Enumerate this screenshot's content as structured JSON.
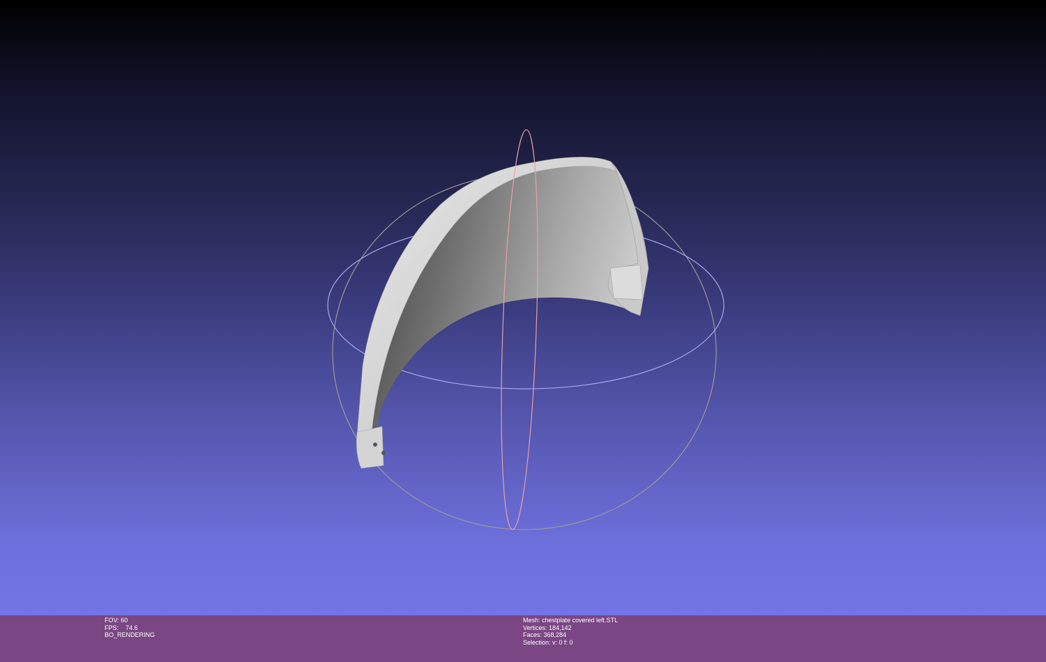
{
  "viewer": {
    "mesh_name": "chestplate covered left.STL"
  },
  "status_left": {
    "fov": "FOV: 60",
    "fps": "FPS:    74.6",
    "render_mode": "BO_RENDERING"
  },
  "status_right": {
    "mesh": "Mesh: chestplate covered left.STL",
    "vertices": "Vertices: 184,142",
    "faces": "Faces: 368,284",
    "selection": "Selection: v: 0 f: 0"
  },
  "colors": {
    "info_bar": "#7a4684",
    "trackball_x": "#e8a0a8",
    "trackball_y": "#a8a8f0",
    "trackball_z": "#9a9a9a",
    "mesh": "#d8d8d8"
  },
  "icons": {
    "trackball": "trackball-gizmo",
    "mesh": "mesh-model"
  }
}
